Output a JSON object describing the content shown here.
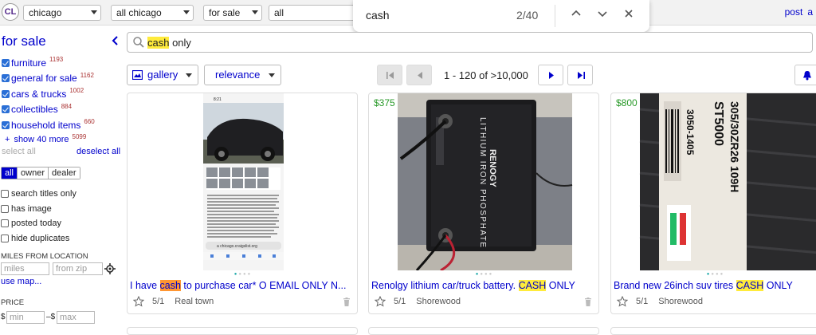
{
  "topbar": {
    "logo": "CL",
    "selects": [
      "chicago",
      "all chicago",
      "for sale",
      "all"
    ],
    "links": [
      "post",
      "a"
    ]
  },
  "findbar": {
    "query": "cash",
    "count": "2/40",
    "up_icon": "chevron-up-icon",
    "down_icon": "chevron-down-icon",
    "close_icon": "close-icon"
  },
  "sidebar": {
    "title": "for sale",
    "categories": [
      {
        "label": "furniture",
        "count": "1193"
      },
      {
        "label": "general for sale",
        "count": "1162"
      },
      {
        "label": "cars & trucks",
        "count": "1002"
      },
      {
        "label": "collectibles",
        "count": "884"
      },
      {
        "label": "household items",
        "count": "660"
      }
    ],
    "show_more": "show 40 more",
    "show_more_count": "5099",
    "select_all": "select all",
    "deselect_all": "deselect all",
    "seller_types": [
      "all",
      "owner",
      "dealer"
    ],
    "seller_selected": "all",
    "options": [
      "search titles only",
      "has image",
      "posted today",
      "hide duplicates"
    ],
    "miles_label": "MILES FROM LOCATION",
    "miles_placeholder": "miles",
    "zip_placeholder": "from zip",
    "use_map": "use map...",
    "price_label": "PRICE",
    "price_currency": "$",
    "price_sep": "–",
    "min_placeholder": "min",
    "max_placeholder": "max"
  },
  "search": {
    "value_highlight": "cash",
    "value_rest": " only"
  },
  "toolbar": {
    "view": "gallery",
    "sort": "relevance",
    "pagination": "1 - 120 of >10,000"
  },
  "cards": [
    {
      "price": "",
      "title_pre": "I have ",
      "title_hl": "cash",
      "title_post": " to purchase car* O EMAIL ONLY N...",
      "date": "5/1",
      "location": "Real town",
      "hl_style": "orange"
    },
    {
      "price": "$375",
      "title_pre": "Renolgy lithium car/truck battery. ",
      "title_hl": "CASH",
      "title_post": " ONLY",
      "date": "5/1",
      "location": "Shorewood",
      "hl_style": "yellow"
    },
    {
      "price": "$800",
      "title_pre": "Brand new 26inch suv tires ",
      "title_hl": "CASH",
      "title_post": " ONLY",
      "date": "5/1",
      "location": "Shorewood",
      "hl_style": "yellow"
    }
  ],
  "card_images": {
    "screenshot_status": "8:21",
    "screenshot_url": "a chicago.craigslist.org",
    "battery_brand": "RENOGY",
    "battery_text": "LITHIUM IRON PHOSPHATE",
    "tire_text_1": "3050-1405",
    "tire_text_2": "ST5000",
    "tire_text_3": "305/30ZR26 109H"
  },
  "colors": {
    "link": "#0000cc",
    "price": "#2a9a2a",
    "highlight": "#ffeb3b",
    "highlight_active": "#ff9632"
  }
}
